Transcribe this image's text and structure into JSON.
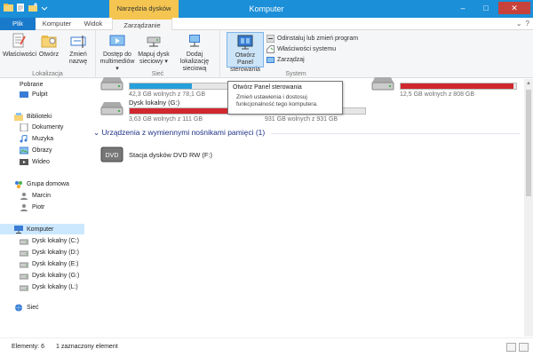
{
  "window": {
    "title": "Komputer"
  },
  "titlebar": {
    "context_tab_group": "Narzędzia dysków",
    "buttons": {
      "minimize": "–",
      "maximize": "□",
      "close": "✕"
    }
  },
  "tabs": [
    {
      "label": "Plik"
    },
    {
      "label": "Komputer"
    },
    {
      "label": "Widok"
    },
    {
      "label": "Zarządzanie"
    }
  ],
  "tab_right": {
    "chevron": "⌄",
    "help": "?"
  },
  "ribbon": {
    "groups": {
      "lokalizacja": {
        "label": "Lokalizacja",
        "buttons": [
          {
            "label": "Właściwości"
          },
          {
            "label": "Otwórz"
          },
          {
            "label": "Zmień nazwę"
          }
        ]
      },
      "siec": {
        "label": "Sieć",
        "buttons": [
          {
            "label": "Dostęp do multimediów ▾"
          },
          {
            "label": "Mapuj dysk sieciowy ▾"
          },
          {
            "label": "Dodaj lokalizację sieciową"
          }
        ]
      },
      "system": {
        "label": "System",
        "big_button": {
          "label": "Otwórz Panel sterowania"
        },
        "small_buttons": [
          {
            "label": "Odinstaluj lub zmień program"
          },
          {
            "label": "Właściwości systemu"
          },
          {
            "label": "Zarządzaj"
          }
        ]
      }
    }
  },
  "nav": {
    "items": [
      {
        "label": "Pobrane"
      },
      {
        "label": "Pulpit"
      },
      {
        "label": "Biblioteki"
      },
      {
        "label": "Dokumenty"
      },
      {
        "label": "Muzyka"
      },
      {
        "label": "Obrazy"
      },
      {
        "label": "Wideo"
      },
      {
        "label": "Grupa domowa"
      },
      {
        "label": "Marcin"
      },
      {
        "label": "Piotr"
      },
      {
        "label": "Komputer"
      },
      {
        "label": "Dysk lokalny (C:)"
      },
      {
        "label": "Dysk lokalny (D:)"
      },
      {
        "label": "Dysk lokalny (E:)"
      },
      {
        "label": "Dysk lokalny (G:)"
      },
      {
        "label": "Dysk lokalny (L:)"
      },
      {
        "label": "Sieć"
      }
    ]
  },
  "content": {
    "drives": [
      {
        "name": "",
        "free": "42,3 GB wolnych z 78,1 GB",
        "used_fraction": 0.46
      },
      {
        "name": "",
        "free": "12,5 GB wolnych z 808 GB",
        "used_fraction": 0.98
      },
      {
        "name": "Dysk lokalny (G:)",
        "free": "3,63 GB wolnych z 111 GB",
        "used_fraction": 0.97
      },
      {
        "name": "",
        "free": "931 GB wolnych z 931 GB",
        "used_fraction": 0.0
      }
    ],
    "removable_section": {
      "header": "Urządzenia z wymiennymi nośnikami pamięci (1)"
    },
    "dvd": {
      "label": "DVD",
      "name": "Stacja dysków DVD RW (F:)"
    }
  },
  "tooltip": {
    "title": "Otwórz Panel sterowania",
    "body": "Zmień ustawienia i dostosuj funkcjonalność tego komputera."
  },
  "statusbar": {
    "elements": "Elementy: 6",
    "selected": "1 zaznaczony element"
  },
  "colors": {
    "titlebar": "#1b8fd8",
    "context_tab": "#f4c550",
    "drive_bar_red": "#d0282f",
    "drive_bar_blue": "#26a0da",
    "section_header": "#1e3287"
  }
}
